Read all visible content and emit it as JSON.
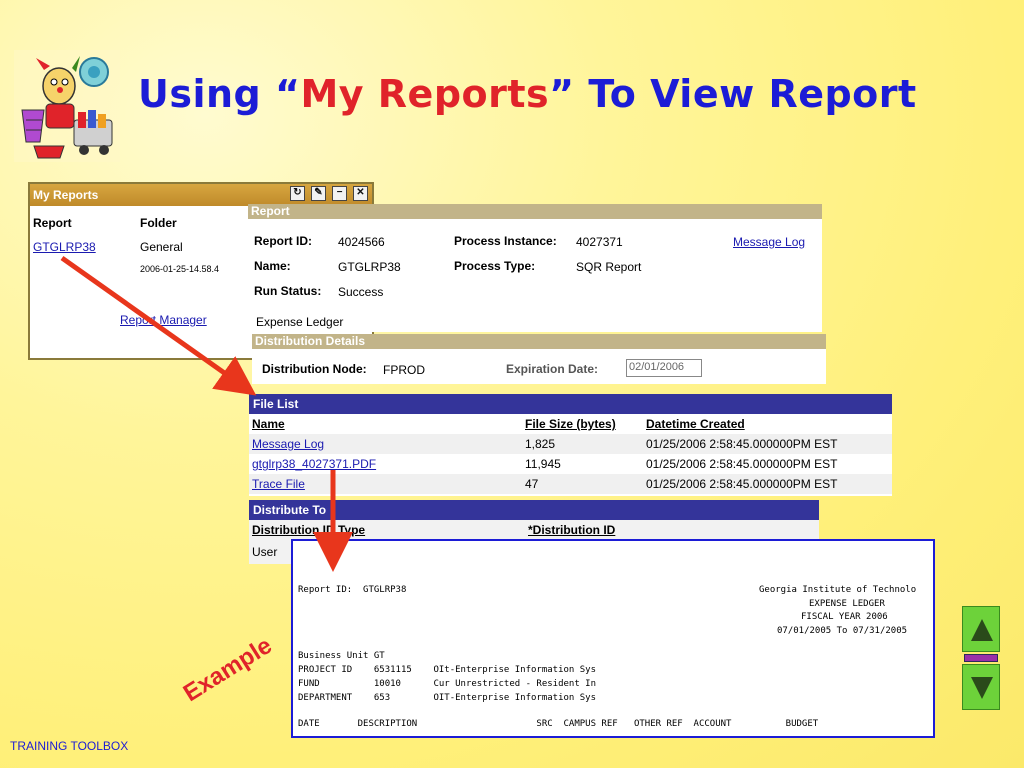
{
  "slide": {
    "title_pre": "Using “",
    "title_highlight": "My Reports",
    "title_post": "” To View Report",
    "footer": "TRAINING TOOLBOX",
    "example_label": "Example",
    "colors": {
      "title": "#1c1cd6",
      "highlight": "#e0232a",
      "arrow": "#e8361c",
      "header_dark": "#34349a",
      "header_tan": "#c2b489"
    }
  },
  "my_reports": {
    "title": "My Reports",
    "controls": [
      "refresh-icon",
      "edit-icon",
      "minimize-icon",
      "close-icon"
    ],
    "col_report": "Report",
    "col_folder": "Folder",
    "report_link": "GTGLRP38",
    "folder": "General",
    "timestamp": "2006-01-25-14.58.4",
    "manager_link": "Report Manager"
  },
  "report": {
    "header": "Report",
    "report_id_label": "Report ID:",
    "report_id": "4024566",
    "process_instance_label": "Process Instance:",
    "process_instance": "4027371",
    "message_log_link": "Message Log",
    "name_label": "Name:",
    "name": "GTGLRP38",
    "process_type_label": "Process Type:",
    "process_type": "SQR Report",
    "run_status_label": "Run Status:",
    "run_status": "Success",
    "description": "Expense Ledger"
  },
  "distribution_details": {
    "header": "Distribution Details",
    "node_label": "Distribution Node:",
    "node": "FPROD",
    "expiration_label": "Expiration Date:",
    "expiration": "02/01/2006"
  },
  "file_list": {
    "header": "File List",
    "columns": [
      "Name",
      "File Size (bytes)",
      "Datetime Created"
    ],
    "rows": [
      {
        "name": "Message Log",
        "size": "1,825",
        "created": "01/25/2006  2:58:45.000000PM EST"
      },
      {
        "name": "gtglrp38_4027371.PDF",
        "size": "11,945",
        "created": "01/25/2006  2:58:45.000000PM EST"
      },
      {
        "name": "Trace File",
        "size": "47",
        "created": "01/25/2006  2:58:45.000000PM EST"
      }
    ]
  },
  "distribute_to": {
    "header": "Distribute To",
    "col_type": "Distribution ID Type",
    "col_id": "*Distribution ID",
    "row_type": "User"
  },
  "printout": {
    "lines": [
      "Report ID:  GTGLRP38",
      "Georgia Institute of Technolo",
      "EXPENSE LEDGER",
      "FISCAL YEAR 2006",
      "07/01/2005 To 07/31/2005",
      "Business Unit GT",
      "PROJECT ID    6531115    OIt-Enterprise Information Sys",
      "FUND          10010      Cur Unrestricted - Resident In",
      "DEPARTMENT    653        OIT-Enterprise Information Sys",
      "DATE       DESCRIPTION                      SRC  CAMPUS REF   OTHER REF  ACCOUNT          BUDGET"
    ]
  },
  "nav": {
    "up_icon": "arrow-up-icon",
    "down_icon": "arrow-down-icon"
  }
}
